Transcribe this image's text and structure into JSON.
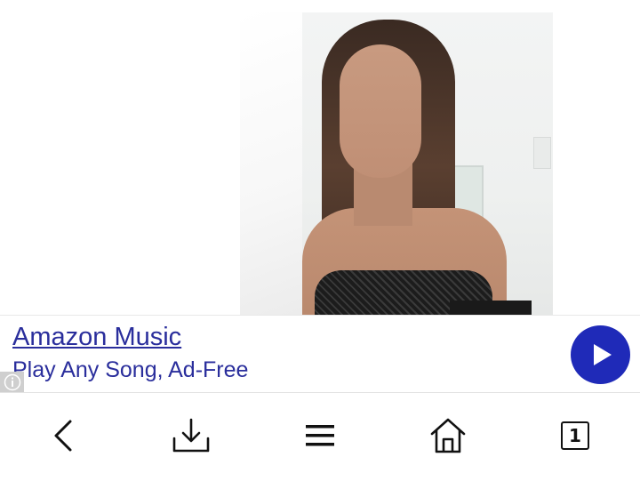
{
  "ad": {
    "title": "Amazon Music",
    "subtitle": "Play Any Song, Ad-Free",
    "accent_color": "#2a2e9c",
    "play_button_color": "#1f2ab8",
    "play_icon": "play-icon",
    "info_icon": "info-icon"
  },
  "bottom_nav": {
    "back_icon": "back-arrow-icon",
    "download_icon": "download-icon",
    "menu_icon": "hamburger-menu-icon",
    "home_icon": "home-icon",
    "tabs_icon": "tabs-icon",
    "tab_count": "1"
  }
}
